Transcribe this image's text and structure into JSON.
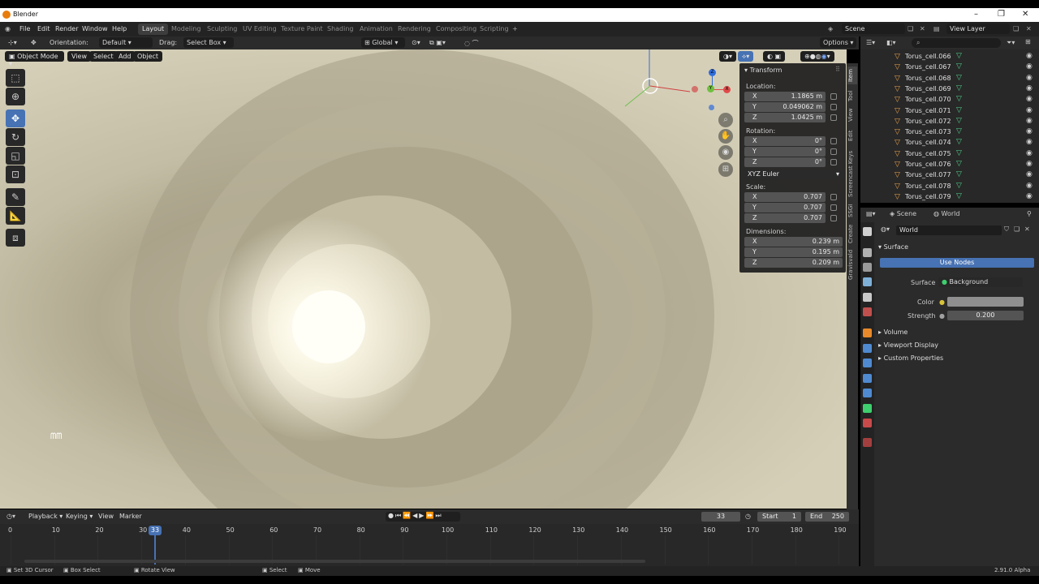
{
  "window": {
    "title": "Blender"
  },
  "menu": [
    "File",
    "Edit",
    "Render",
    "Window",
    "Help"
  ],
  "workspaces": [
    "Layout",
    "Modeling",
    "Sculpting",
    "UV Editing",
    "Texture Paint",
    "Shading",
    "Animation",
    "Rendering",
    "Compositing",
    "Scripting"
  ],
  "scene": "Scene",
  "view_layer": "View Layer",
  "header": {
    "orientation_label": "Orientation:",
    "orientation_value": "Default",
    "drag_label": "Drag:",
    "drag_value": "Select Box",
    "transform_orient": "Global",
    "options": "Options"
  },
  "viewport": {
    "mode": "Object Mode",
    "menus": [
      "View",
      "Select",
      "Add",
      "Object"
    ]
  },
  "npanel": {
    "title": "Transform",
    "location_label": "Location:",
    "location": {
      "x": "1.1865 m",
      "y": "0.049062 m",
      "z": "1.0425 m"
    },
    "rotation_label": "Rotation:",
    "rotation": {
      "x": "0°",
      "y": "0°",
      "z": "0°"
    },
    "rotation_mode": "XYZ Euler",
    "scale_label": "Scale:",
    "scale": {
      "x": "0.707",
      "y": "0.707",
      "z": "0.707"
    },
    "dimensions_label": "Dimensions:",
    "dimensions": {
      "x": "0.239 m",
      "y": "0.195 m",
      "z": "0.209 m"
    },
    "axes": [
      "X",
      "Y",
      "Z"
    ],
    "tabs": [
      "Item",
      "Tool",
      "View",
      "Edit",
      "Screencast Keys",
      "SSGI",
      "Create",
      "Gravisvald"
    ]
  },
  "outliner": {
    "items": [
      "Torus_cell.066",
      "Torus_cell.067",
      "Torus_cell.068",
      "Torus_cell.069",
      "Torus_cell.070",
      "Torus_cell.071",
      "Torus_cell.072",
      "Torus_cell.073",
      "Torus_cell.074",
      "Torus_cell.075",
      "Torus_cell.076",
      "Torus_cell.077",
      "Torus_cell.078",
      "Torus_cell.079"
    ]
  },
  "properties": {
    "breadcrumb_scene": "Scene",
    "breadcrumb_world": "World",
    "world_name": "World",
    "surface_header": "Surface",
    "use_nodes": "Use Nodes",
    "surface_label": "Surface",
    "surface_value": "Background",
    "color_label": "Color",
    "strength_label": "Strength",
    "strength_value": "0.200",
    "collapsed": [
      "Volume",
      "Viewport Display",
      "Custom Properties"
    ]
  },
  "timeline": {
    "menus": [
      "Playback",
      "Keying",
      "View",
      "Marker"
    ],
    "current_frame": "33",
    "start_label": "Start",
    "start": "1",
    "end_label": "End",
    "end": "250",
    "ticks": [
      "0",
      "10",
      "20",
      "30",
      "40",
      "50",
      "60",
      "70",
      "80",
      "90",
      "100",
      "110",
      "120",
      "130",
      "140",
      "150",
      "160",
      "170",
      "180",
      "190"
    ]
  },
  "status": {
    "items": [
      "Set 3D Cursor",
      "Box Select",
      "Rotate View",
      "Select",
      "Move"
    ],
    "version": "2.91.0 Alpha"
  }
}
